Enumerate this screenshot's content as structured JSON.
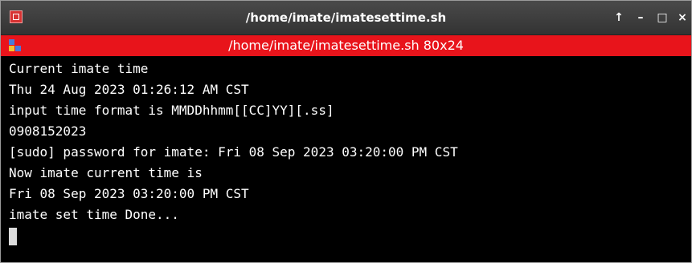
{
  "window": {
    "title": "/home/imate/imatesettime.sh",
    "controls": {
      "up": "↑",
      "minimize": "–",
      "maximize": "□",
      "close": "×"
    },
    "icon": "terminal-app-icon"
  },
  "terminal": {
    "title": "/home/imate/imatesettime.sh 80x24",
    "icon": "terminal-tile-icon",
    "accent_color": "#e8141b",
    "lines": [
      "Current imate time",
      "Thu 24 Aug 2023 01:26:12 AM CST",
      "input time format is MMDDhhmm[[CC]YY][.ss]",
      "0908152023",
      "[sudo] password for imate: Fri 08 Sep 2023 03:20:00 PM CST",
      "Now imate current time is",
      "Fri 08 Sep 2023 03:20:00 PM CST",
      "imate set time Done..."
    ]
  }
}
